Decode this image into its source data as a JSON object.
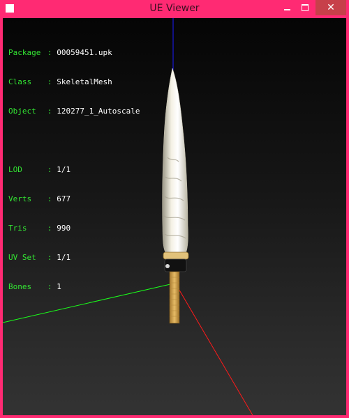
{
  "window": {
    "title": "UE Viewer",
    "minimize_icon": "minimize-icon",
    "maximize_icon": "maximize-icon",
    "close_icon": "close-icon",
    "close_glyph": "✕"
  },
  "info_panel": {
    "rows_top": [
      {
        "key": "Package",
        "sep": ":",
        "value": "00059451.upk"
      },
      {
        "key": "Class  ",
        "sep": ":",
        "value": "SkeletalMesh"
      },
      {
        "key": "Object ",
        "sep": ":",
        "value": "120277_1_Autoscale"
      }
    ],
    "rows_bottom": [
      {
        "key": "LOD    ",
        "sep": ":",
        "value": "1/1"
      },
      {
        "key": "Verts  ",
        "sep": ":",
        "value": "677"
      },
      {
        "key": "Tris   ",
        "sep": ":",
        "value": "990"
      },
      {
        "key": "UV Set ",
        "sep": ":",
        "value": "1/1"
      },
      {
        "key": "Bones  ",
        "sep": ":",
        "value": "1"
      }
    ]
  },
  "colors": {
    "title_bar": "#ff2a73",
    "close_button": "#c7404a",
    "label_green": "#33e633",
    "axis_x": "#ff1a1a",
    "axis_y": "#1aff1a",
    "axis_z": "#1a1aff",
    "blade": "#ece8d8",
    "handle": "#d8a850"
  }
}
